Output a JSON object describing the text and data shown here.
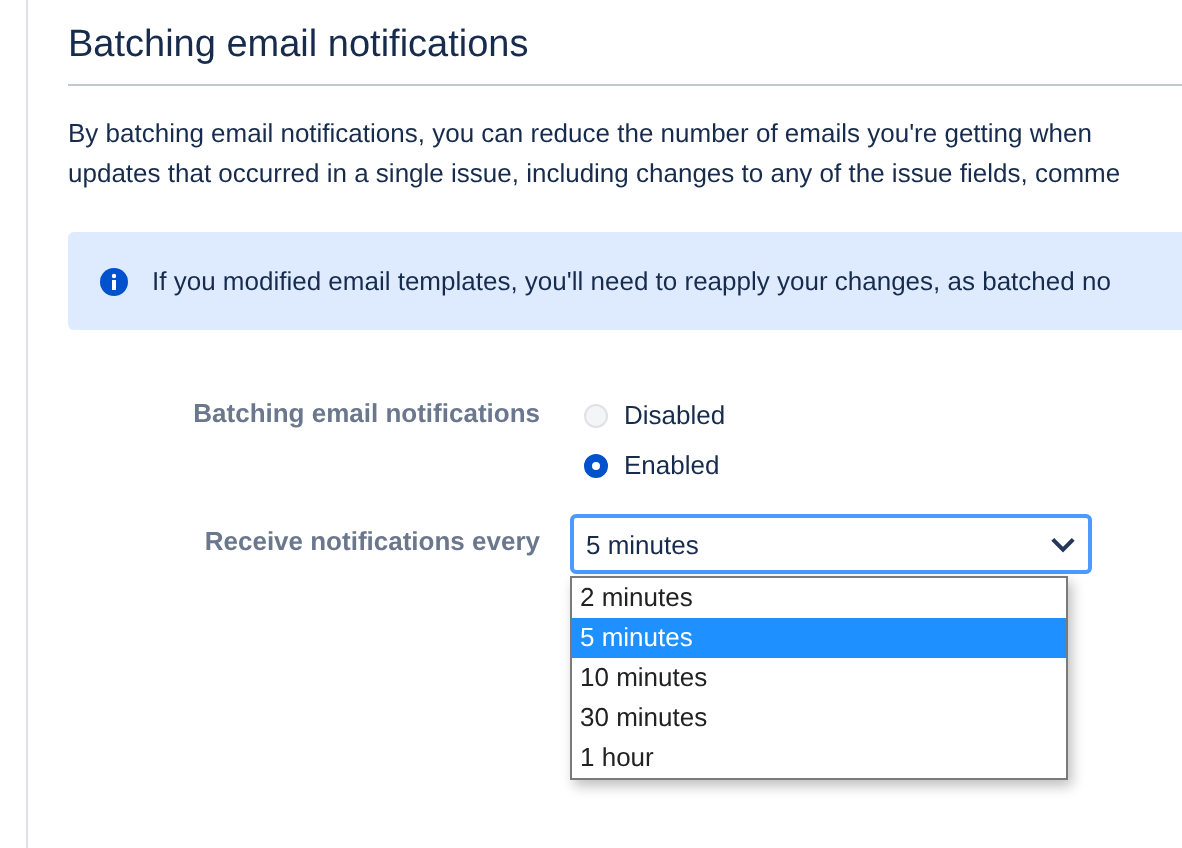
{
  "heading": "Batching email notifications",
  "description": [
    "By batching email notifications, you can reduce the number of emails you're getting when",
    "updates that occurred in a single issue, including changes to any of the issue fields, comme"
  ],
  "info": {
    "text": "If you modified email templates, you'll need to reapply your changes, as batched no"
  },
  "form": [
    {
      "kind": "radio",
      "label": "Batching email notifications",
      "options": [
        {
          "label": "Disabled",
          "selected": false
        },
        {
          "label": "Enabled",
          "selected": true
        }
      ]
    },
    {
      "kind": "select",
      "label": "Receive notifications every",
      "value": "5 minutes",
      "expanded": true,
      "options": [
        {
          "label": "2 minutes",
          "selected": false
        },
        {
          "label": "5 minutes",
          "selected": true
        },
        {
          "label": "10 minutes",
          "selected": false
        },
        {
          "label": "30 minutes",
          "selected": false
        },
        {
          "label": "1 hour",
          "selected": false
        }
      ]
    }
  ]
}
